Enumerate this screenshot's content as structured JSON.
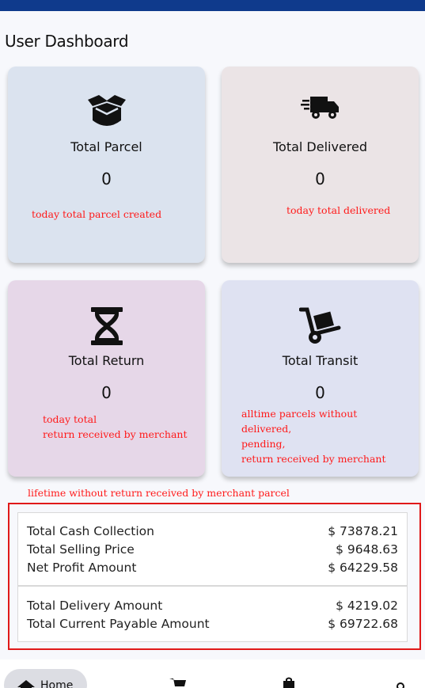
{
  "page": {
    "title": "User Dashboard"
  },
  "cards": {
    "parcel": {
      "title": "Total Parcel",
      "count": "0",
      "icon": "box-open-icon"
    },
    "delivered": {
      "title": "Total Delivered",
      "count": "0",
      "icon": "truck-fast-icon"
    },
    "return": {
      "title": "Total Return",
      "count": "0",
      "icon": "hourglass-icon"
    },
    "transit": {
      "title": "Total Transit",
      "count": "0",
      "icon": "dolly-icon"
    }
  },
  "annotations": {
    "parcel": [
      "today total parcel created"
    ],
    "delivered": [
      "today total delivered"
    ],
    "return": [
      "today total",
      "return received by merchant"
    ],
    "transit": [
      "alltime parcels  without",
      "delivered,",
      "pending,",
      "return received by merchant"
    ],
    "summary": "lifetime without return received by merchant parcel"
  },
  "summary": {
    "group1": [
      {
        "label": "Total Cash Collection",
        "value": "$ 73878.21"
      },
      {
        "label": "Total Selling Price",
        "value": "$ 9648.63"
      },
      {
        "label": "Net Profit Amount",
        "value": "$ 64229.58"
      }
    ],
    "group2": [
      {
        "label": "Total Delivery Amount",
        "value": "$ 4219.02"
      },
      {
        "label": "Total Current Payable Amount",
        "value": "$ 69722.68"
      }
    ]
  },
  "bottom_nav": {
    "home": {
      "label": "Home",
      "icon": "home-icon"
    },
    "items": [
      {
        "icon": "cart-icon"
      },
      {
        "icon": "shop-icon"
      },
      {
        "icon": "user-icon"
      }
    ]
  },
  "colors": {
    "top_bar": "#0f3a8c",
    "annotation": "#ff1a1a",
    "card_parcel": "#dbe3ef",
    "card_delivered": "#ebe4e6",
    "card_return": "#e6d7e8",
    "card_transit": "#dfe2f2"
  }
}
